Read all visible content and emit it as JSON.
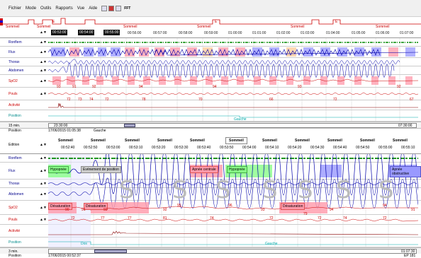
{
  "menubar": {
    "items": [
      "Fichier",
      "Mode",
      "Outils",
      "Rapports",
      "Vue",
      "Aide"
    ],
    "fft_label": "FFT"
  },
  "hypnogram": {
    "labels": [
      "Sommeil",
      "Sommeil",
      "Sommeil",
      "Sommeil",
      "Sommeil",
      "Sommeil",
      "Sommeil"
    ],
    "small_labels": [
      "E",
      "E",
      "E"
    ]
  },
  "timebar_top": {
    "ticks": [
      "00:53:00",
      "00:54:00",
      "00:55:00",
      "00:56:00",
      "00:57:00",
      "00:58:00",
      "00:59:00",
      "01:00:00",
      "01:01:00",
      "01:02:00",
      "01:03:00",
      "01:04:00",
      "01:05:00",
      "01:06:00",
      "01:07:00"
    ]
  },
  "channels_top": [
    {
      "label": "Ronflem"
    },
    {
      "label": "Flux"
    },
    {
      "label": "Thorax"
    },
    {
      "label": "Abdomen"
    },
    {
      "label": "SpO2"
    },
    {
      "label": "Pouls"
    },
    {
      "label": "Activité"
    },
    {
      "label": "Position"
    }
  ],
  "spo2_values_top": [
    "93",
    "91",
    "92",
    "94",
    "94",
    "93",
    "92",
    "92",
    "92",
    "93",
    "91",
    "91",
    "92",
    "91",
    "92",
    "91",
    "91",
    "92",
    "93"
  ],
  "pouls_values_top": [
    "72",
    "73",
    "74",
    "72",
    "78",
    "77",
    "78",
    "75",
    "70",
    "78",
    "67",
    "68",
    "66",
    "72",
    "72",
    "73",
    "71",
    "67",
    "72",
    "70",
    "71",
    "70",
    "67",
    "73",
    "67"
  ],
  "position_top": "Gauche",
  "info_top": {
    "window": "15 min.",
    "time_start": "23:30:00",
    "time_end": "07:30:00",
    "position_label": "Position",
    "datetime": "17/06/2015 01:05:38",
    "position_value": "Gauche"
  },
  "epoch": {
    "edition_label": "Edition",
    "titles": [
      "Sommeil",
      "Sommeil",
      "Sommeil",
      "Sommeil",
      "Sommeil",
      "Sommeil",
      "Sommeil",
      "Sommeil",
      "Sommeil",
      "Sommeil",
      "Sommeil",
      "Sommeil",
      "Sommeil"
    ],
    "times": [
      "00:52:40",
      "00:52:50",
      "00:53:00",
      "00:53:10",
      "00:53:20",
      "00:53:30",
      "00:53:40",
      "00:53:50",
      "00:54:00",
      "00:54:10",
      "00:54:20",
      "00:54:30",
      "00:54:40",
      "00:54:50",
      "00:55:00",
      "00:55:10",
      "00:55:20"
    ]
  },
  "channels_bottom": [
    {
      "label": "Ronflem"
    },
    {
      "label": "Flux"
    },
    {
      "label": "Thorax"
    },
    {
      "label": "Abdomen"
    },
    {
      "label": "SpO2"
    },
    {
      "label": "Pouls"
    },
    {
      "label": "Activité"
    },
    {
      "label": "Position"
    }
  ],
  "events_bottom": {
    "hypopnee1": "Hypopnée",
    "evenement": "Evénement de position",
    "apnee_centrale": "Apnée centrale",
    "hypopnee2": "Hypopnée",
    "apnee_obstructive": "Apnée obstructive",
    "desat1": "Désaturation",
    "desat2": "Désaturation",
    "desat3": "Désaturation"
  },
  "spo2_values_bottom": [
    "90",
    "91",
    "92",
    "92",
    "95",
    "96",
    "93",
    "94",
    "94",
    "95",
    "94",
    "91"
  ],
  "pouls_values_bottom": [
    "72",
    "77",
    "77",
    "81",
    "74",
    "79",
    "72",
    "72",
    "74",
    "72",
    "74"
  ],
  "position_bottom": {
    "left": "Dos",
    "right": "Gauche"
  },
  "info_bottom": {
    "window": "3 min.",
    "time_end": "01:07:30",
    "label": "Position",
    "datetime": "17/06/2015 00:52:37",
    "page": "EP 181"
  },
  "colors": {
    "accent_red": "#cc0000",
    "flux_blue": "#0000aa",
    "event_green": "#88ff88",
    "event_red": "#ff99aa",
    "event_blue": "#9999ff"
  }
}
